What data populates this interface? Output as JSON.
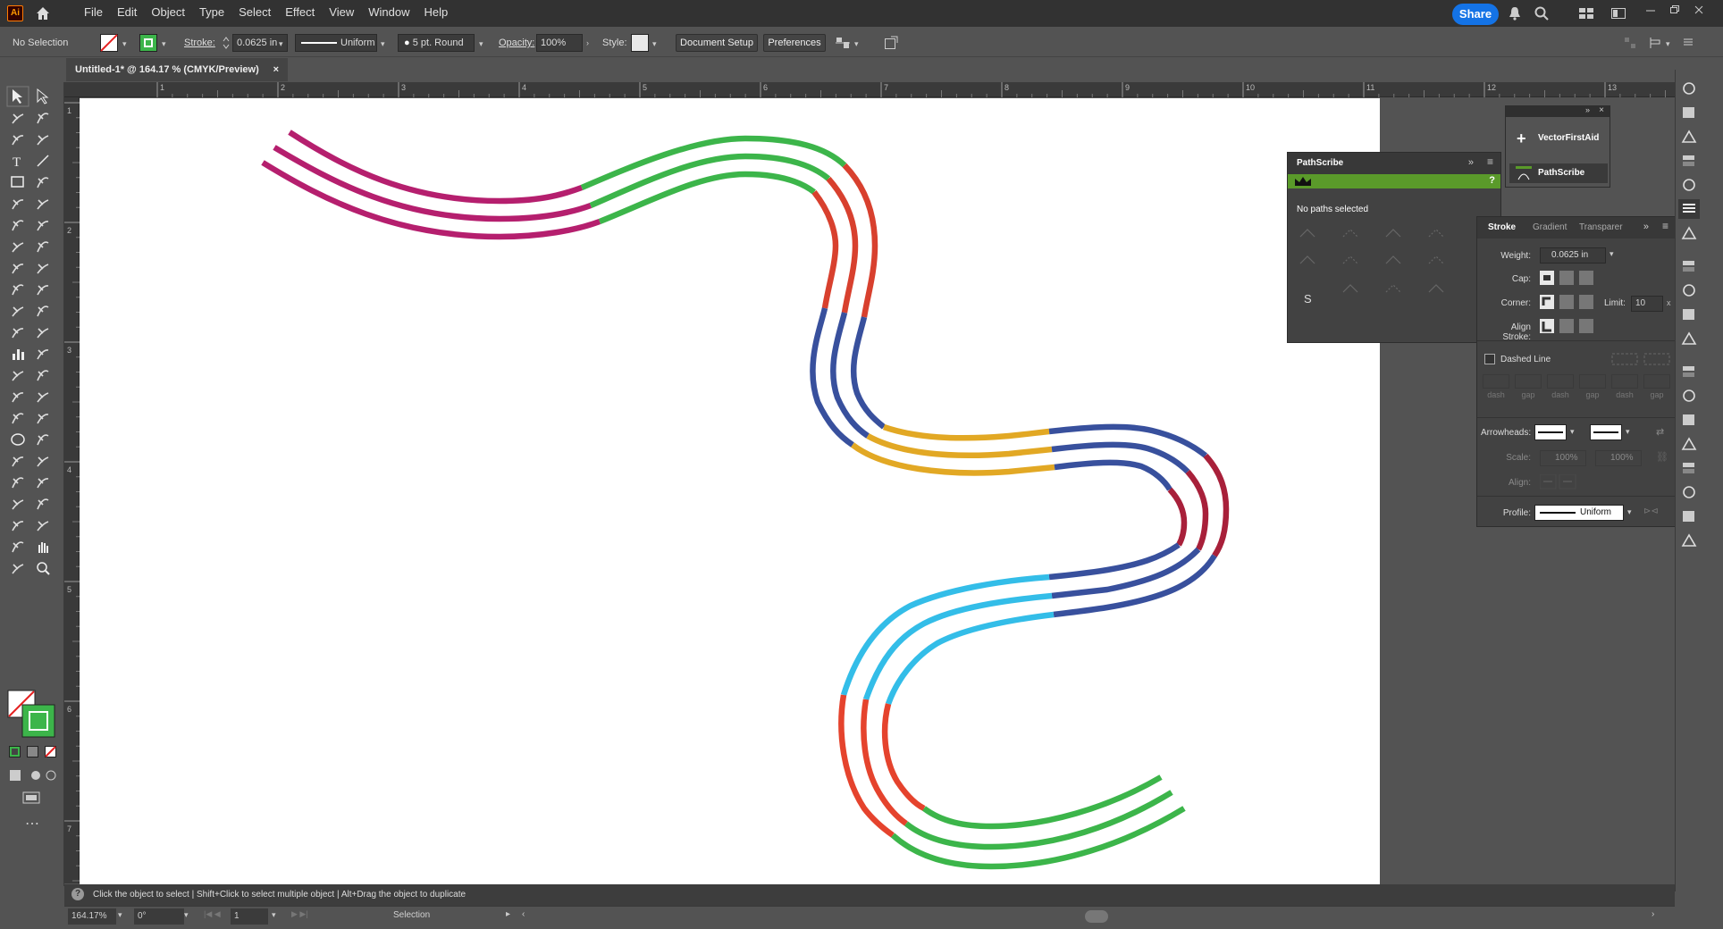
{
  "app": {
    "logo_text": "Ai"
  },
  "menu": [
    "File",
    "Edit",
    "Object",
    "Type",
    "Select",
    "Effect",
    "View",
    "Window",
    "Help"
  ],
  "share_label": "Share",
  "control": {
    "selection_state": "No Selection",
    "stroke_label": "Stroke:",
    "stroke_weight": "0.0625 in",
    "profile": "Uniform",
    "brush": "5 pt. Round",
    "opacity_label": "Opacity:",
    "opacity": "100%",
    "style_label": "Style:",
    "document_setup": "Document Setup",
    "preferences": "Preferences"
  },
  "document_tab": {
    "title": "Untitled-1* @ 164.17 % (CMYK/Preview)",
    "close": "×"
  },
  "rulers": {
    "h_ticks": [
      "1",
      "2",
      "3",
      "4",
      "5",
      "6",
      "7",
      "8",
      "9",
      "10",
      "11",
      "12",
      "13"
    ],
    "v_ticks": [
      "1",
      "2",
      "3",
      "4",
      "5",
      "6",
      "7"
    ]
  },
  "pathscribe_panel": {
    "title": "PathScribe",
    "help": "?",
    "status": "No paths selected",
    "letter_tool": "S"
  },
  "plugin_list": {
    "items": [
      "VectorFirstAid",
      "PathScribe"
    ]
  },
  "stroke_panel": {
    "tabs": [
      "Stroke",
      "Gradient",
      "Transparer"
    ],
    "weight_label": "Weight:",
    "weight": "0.0625 in",
    "cap_label": "Cap:",
    "corner_label": "Corner:",
    "limit_label": "Limit:",
    "limit": "10",
    "align_label": "Align Stroke:",
    "dashed_label": "Dashed Line",
    "dash_labels": [
      "dash",
      "gap",
      "dash",
      "gap",
      "dash",
      "gap"
    ],
    "arrowheads_label": "Arrowheads:",
    "scale_label": "Scale:",
    "scale_a": "100%",
    "scale_b": "100%",
    "align_arrow_label": "Align:",
    "profile_label": "Profile:",
    "profile": "Uniform"
  },
  "status": {
    "hint": "Click the object to select  |  Shift+Click to select multiple object  |  Alt+Drag the object to duplicate",
    "zoom": "164.17%",
    "rotation": "0°",
    "artboard": "1",
    "tool": "Selection"
  },
  "colors": {
    "magenta": "#b51f6e",
    "green": "#3cb54a",
    "red": "#d8402e",
    "blue": "#38509d",
    "yellow": "#e2a824",
    "crimson": "#a8203a",
    "cyan": "#33bde8",
    "orange_red": "#e5432d",
    "accent": "#1473e6",
    "panel_green": "#5a9a2a"
  }
}
